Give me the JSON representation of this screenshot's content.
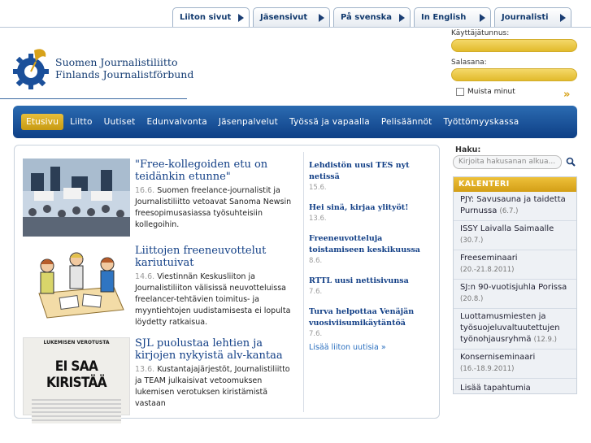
{
  "tabs": [
    {
      "label": "Liiton sivut"
    },
    {
      "label": "Jäsensivut"
    },
    {
      "label": "På svenska"
    },
    {
      "label": "In English"
    },
    {
      "label": "Journalisti"
    }
  ],
  "logo": {
    "line1": "Suomen Journalistiliitto",
    "line2": "Finlands Journalistförbund"
  },
  "login": {
    "username_label": "Käyttäjätunnus:",
    "password_label": "Salasana:",
    "remember_label": "Muista minut",
    "submit_glyph": "»"
  },
  "nav": [
    "Etusivu",
    "Liitto",
    "Uutiset",
    "Edunvalvonta",
    "Jäsenpalvelut",
    "Työssä ja vapaalla",
    "Pelisäännöt",
    "Työttömyyskassa"
  ],
  "features": [
    {
      "title": "\"Free-kollegoiden etu on teidänkin etunne\"",
      "date": "16.6.",
      "text": "Suomen freelance-journalistit ja Journalistiliitto vetoavat Sanoma Newsin freesopimusasiassa työsuhteisiin kollegoihin."
    },
    {
      "title": "Liittojen freeneuvottelut kariutuivat",
      "date": "14.6.",
      "text": "Viestinnän Keskusliiton ja Journalistiliiton välisissä neuvotteluissa freelancer-tehtävien toimitus- ja myyntiehtojen uudistamisesta ei lopulta löydetty ratkaisua."
    },
    {
      "title": "SJL puolustaa lehtien ja kirjojen nykyistä alv-kantaa",
      "date": "13.6.",
      "text": "Kustantajajärjestöt, Journalistiliitto ja TEAM julkaisivat vetoomuksen lukemisen verotuksen kiristämistä vastaan"
    }
  ],
  "feature3_image": {
    "caption": "LUKEMISEN VEROTUSTA",
    "headline": "EI SAA KIRISTÄÄ"
  },
  "news": [
    {
      "title": "Lehdistön uusi TES nyt netissä",
      "date": "15.6."
    },
    {
      "title": "Hei sinä, kirjaa ylityöt!",
      "date": "13.6."
    },
    {
      "title": "Freeneuvotteluja toistamiseen keskikuussa",
      "date": "8.6."
    },
    {
      "title": "RTTL uusi nettisivunsa",
      "date": "7.6."
    },
    {
      "title": "Turva helpottaa Venäjän vuosiviisumikäytäntöä",
      "date": "7.6."
    }
  ],
  "news_more": "Lisää liiton uutisia »",
  "search": {
    "label": "Haku:",
    "placeholder": "Kirjoita hakusanan alkua..."
  },
  "calendar": {
    "title": "KALENTERI",
    "items": [
      {
        "name": "PJY: Savusauna ja taidetta Purnussa",
        "date": "(6.7.)"
      },
      {
        "name": "ISSY Laivalla Saimaalle",
        "date": "(30.7.)"
      },
      {
        "name": "Freeseminaari",
        "date": "(20.-21.8.2011)"
      },
      {
        "name": "SJ:n 90-vuotisjuhla Porissa",
        "date": "(20.8.)"
      },
      {
        "name": "Luottamusmiesten ja työsuojeluvaltuutettujen työnohjausryhmä",
        "date": "(12.9.)"
      },
      {
        "name": "Konserniseminaari",
        "date": "(16.-18.9.2011)"
      }
    ],
    "more": "Lisää tapahtumia"
  },
  "colors": {
    "brand_blue": "#123f86",
    "accent_gold": "#e2b42c"
  }
}
